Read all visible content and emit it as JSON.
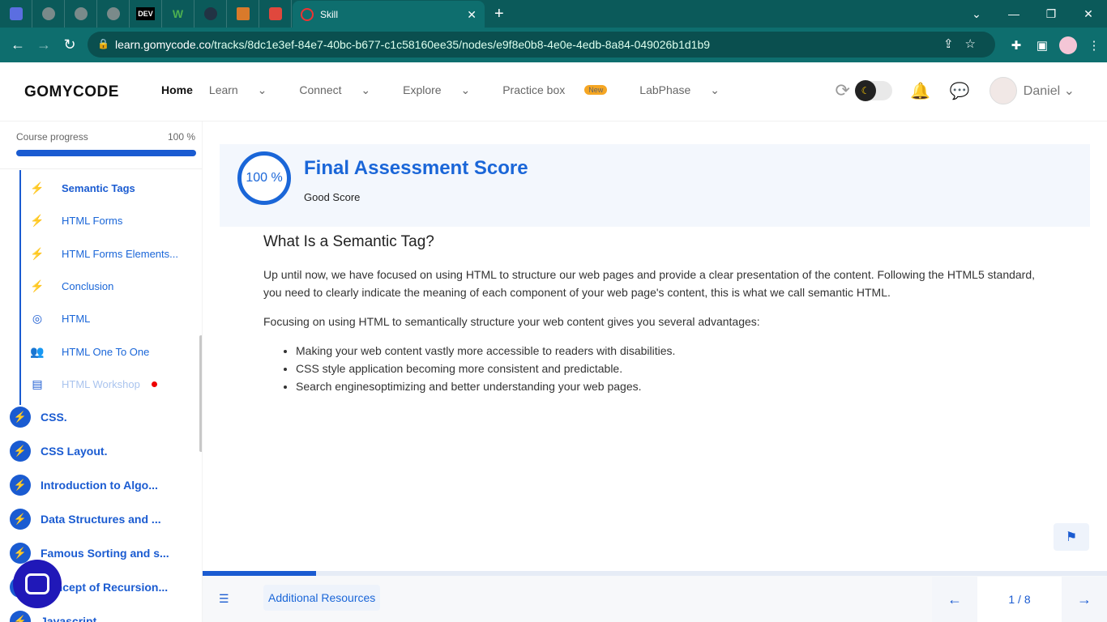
{
  "browser": {
    "active_tab_title": "Skill",
    "pinned_tabs": [
      "",
      "",
      "",
      "DEV",
      "W",
      "",
      "",
      ""
    ],
    "url_host": "learn.gomycode.co",
    "url_path": "/tracks/8dc1e3ef-84e7-40bc-b677-c1c58160ee35/nodes/e9f8e0b8-4e0e-4edb-8a84-049026b1d1b9"
  },
  "header": {
    "logo": "GOMYCODE",
    "menu": {
      "home": "Home",
      "learn": "Learn",
      "connect": "Connect",
      "explore": "Explore",
      "practice": "Practice box",
      "practice_badge": "New",
      "labphase": "LabPhase"
    },
    "username": "Daniel"
  },
  "sidebar": {
    "progress_label": "Course progress",
    "progress_value": "100 %",
    "progress_fraction": 1.0,
    "lessons": [
      {
        "label": "Semantic Tags",
        "icon": "bolt-icon"
      },
      {
        "label": "HTML Forms",
        "icon": "bolt-icon"
      },
      {
        "label": "HTML Forms Elements...",
        "icon": "bolt-icon"
      },
      {
        "label": "Conclusion",
        "icon": "bolt-icon"
      },
      {
        "label": "HTML",
        "icon": "target-icon"
      },
      {
        "label": "HTML One To One",
        "icon": "people-icon"
      },
      {
        "label": "HTML Workshop",
        "icon": "workshop-icon"
      }
    ],
    "modules": [
      "CSS.",
      "CSS Layout.",
      "Introduction to Algo...",
      "Data Structures and ...",
      "Famous Sorting and s...",
      "Concept of Recursion...",
      "Javascript"
    ]
  },
  "score": {
    "percent": "100 %",
    "title": "Final Assessment Score",
    "subtitle": "Good Score"
  },
  "article": {
    "heading": "What Is a Semantic Tag?",
    "para1": "Up until now, we have focused on using HTML to structure our web pages and provide a clear presentation of the content. Following the HTML5 standard, you need to clearly indicate the meaning of each component of your web page's content, this is what we call semantic HTML.",
    "para2": "Focusing on using HTML to semantically structure your web content gives you several advantages:",
    "bullets": [
      "Making your web content vastly more accessible to readers with disabilities.",
      "CSS style application becoming more consistent and predictable.",
      "Search enginesoptimizing and better understanding your web pages."
    ]
  },
  "footer": {
    "additional_resources": "Additional Resources",
    "page_indicator": "1 / 8",
    "progress_fraction": 0.125
  }
}
